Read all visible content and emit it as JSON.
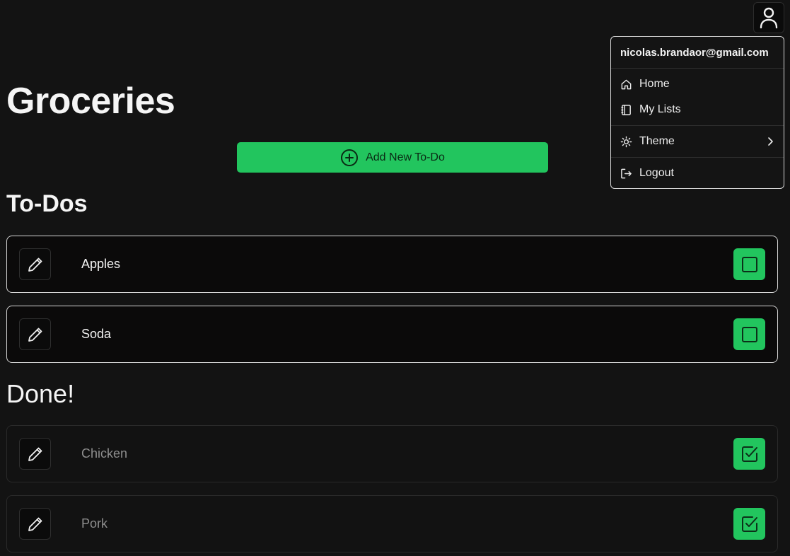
{
  "page": {
    "title": "Groceries"
  },
  "user_menu": {
    "email": "nicolas.brandaor@gmail.com",
    "items": [
      {
        "label": "Home",
        "icon": "home-icon"
      },
      {
        "label": "My Lists",
        "icon": "notebook-icon"
      },
      {
        "label": "Theme",
        "icon": "sun-icon"
      },
      {
        "label": "Logout",
        "icon": "logout-icon"
      }
    ]
  },
  "add_button": {
    "label": "Add New To-Do",
    "icon": "plus-circle-icon"
  },
  "sections": {
    "todos": {
      "heading": "To-Dos",
      "items": [
        {
          "label": "Apples",
          "checked": false
        },
        {
          "label": "Soda",
          "checked": false
        }
      ]
    },
    "done": {
      "heading": "Done!",
      "items": [
        {
          "label": "Chicken",
          "checked": true
        },
        {
          "label": "Pork",
          "checked": true
        }
      ]
    }
  },
  "colors": {
    "accent": "#22c55e",
    "background": "#131313",
    "active_border": "#d6d6d6",
    "done_text": "#8e8e8e"
  }
}
